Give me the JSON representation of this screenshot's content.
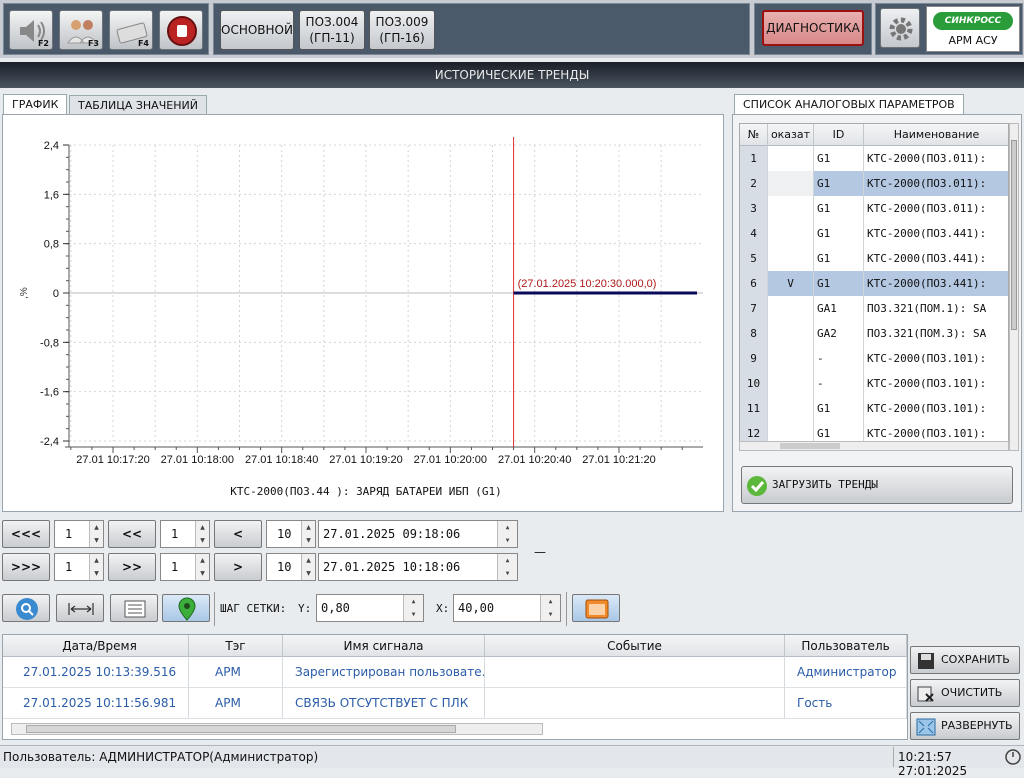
{
  "toolbar": {
    "keys": [
      "F2",
      "F3",
      "F4"
    ],
    "mode_buttons": [
      {
        "label": "ОСНОВНОЙ"
      },
      {
        "line1": "ПОЗ.004",
        "line2": "(ГП-11)"
      },
      {
        "line1": "ПОЗ.009",
        "line2": "(ГП-16)"
      }
    ],
    "diag_label": "ДИАГНОСТИКА",
    "logo_brand": "СИНКРОСС",
    "logo_caption": "АРМ АСУ"
  },
  "window_title": "ИСТОРИЧЕСКИЕ ТРЕНДЫ",
  "tabs": {
    "graph": "ГРАФИК",
    "table": "ТАБЛИЦА ЗНАЧЕНИЙ",
    "params": "СПИСОК АНАЛОГОВЫХ ПАРАМЕТРОВ"
  },
  "chart_data": {
    "type": "line",
    "xlabel": "КТС-2000(ПОЗ.44 ): ЗАРЯД БАТАРЕИ ИБП (G1)",
    "ylabel": ",%",
    "ylim": [
      -2.4,
      2.4
    ],
    "yticks": [
      "2,4",
      "1,6",
      "0,8",
      "0",
      "-0,8",
      "-1,6",
      "-2,4"
    ],
    "xticks": [
      "27.01 10:17:20",
      "27.01 10:18:00",
      "27.01 10:18:40",
      "27.01 10:19:20",
      "27.01 10:20:00",
      "27.01 10:20:40",
      "27.01 10:21:20"
    ],
    "grid": true,
    "series": [
      {
        "x": [
          "27.01.2025 10:20:30",
          "27.01.2025 10:21:57"
        ],
        "y": [
          0,
          0
        ],
        "color": "#0a0a5a"
      }
    ],
    "cursor": {
      "x": "27.01.2025 10:20:30",
      "label": "(27.01.2025 10:20:30.000,0)",
      "color": "#e03030"
    }
  },
  "param_table": {
    "headers": [
      "№",
      "оказат",
      "ID",
      "Наименование"
    ],
    "rows": [
      {
        "n": "1",
        "show": "",
        "id": "G1",
        "name": "КТС-2000(ПОЗ.011):"
      },
      {
        "n": "2",
        "show": "",
        "id": "G1",
        "name": "КТС-2000(ПОЗ.011):"
      },
      {
        "n": "3",
        "show": "",
        "id": "G1",
        "name": "КТС-2000(ПОЗ.011):"
      },
      {
        "n": "4",
        "show": "",
        "id": "G1",
        "name": "КТС-2000(ПОЗ.441):"
      },
      {
        "n": "5",
        "show": "",
        "id": "G1",
        "name": "КТС-2000(ПОЗ.441):"
      },
      {
        "n": "6",
        "show": "V",
        "id": "G1",
        "name": "КТС-2000(ПОЗ.441):"
      },
      {
        "n": "7",
        "show": "",
        "id": "GA1",
        "name": "ПОЗ.321(ПОМ.1): SA"
      },
      {
        "n": "8",
        "show": "",
        "id": "GA2",
        "name": "ПОЗ.321(ПОМ.3): SA"
      },
      {
        "n": "9",
        "show": "",
        "id": "-",
        "name": "КТС-2000(ПОЗ.101):"
      },
      {
        "n": "10",
        "show": "",
        "id": "-",
        "name": "КТС-2000(ПОЗ.101):"
      },
      {
        "n": "11",
        "show": "",
        "id": "G1",
        "name": "КТС-2000(ПОЗ.101):"
      },
      {
        "n": "12",
        "show": "",
        "id": "G1",
        "name": "КТС-2000(ПОЗ.101):"
      }
    ],
    "selected_rows": [
      2,
      6
    ],
    "load_label": "ЗАГРУЗИТЬ ТРЕНДЫ"
  },
  "nav": {
    "row1": {
      "btn1": "<<<",
      "val1": "1",
      "btn2": "<<",
      "val2": "1",
      "btn3": "<",
      "val3": "10",
      "date": "27.01.2025 09:18:06"
    },
    "row2": {
      "btn1": ">>>",
      "val1": "1",
      "btn2": ">>",
      "val2": "1",
      "btn3": ">",
      "val3": "10",
      "date": "27.01.2025 10:18:06"
    },
    "dash": "—"
  },
  "grid_step": {
    "label": "ШАГ СЕТКИ:",
    "y_label": "Y:",
    "y_value": "0,80",
    "x_label": "X:",
    "x_value": "40,00"
  },
  "events": {
    "headers": [
      "Дата/Время",
      "Тэг",
      "Имя сигнала",
      "Событие",
      "Пользователь"
    ],
    "rows": [
      {
        "time": "27.01.2025 10:13:39.516",
        "tag": "АРМ",
        "signal": "Зарегистрирован пользовате...",
        "event": "",
        "user": "Администратор"
      },
      {
        "time": "27.01.2025 10:11:56.981",
        "tag": "АРМ",
        "signal": "СВЯЗЬ ОТСУТСТВУЕТ С ПЛК",
        "event": "",
        "user": "Гость"
      }
    ]
  },
  "side_buttons": {
    "save": "СОХРАНИТЬ",
    "clear": "ОЧИСТИТЬ ВСЕ",
    "expand": "РАЗВЕРНУТЬ"
  },
  "status": {
    "user": "Пользователь: АДМИНИСТРАТОР(Администратор)",
    "clock": "10:21:57 27:01:2025"
  }
}
